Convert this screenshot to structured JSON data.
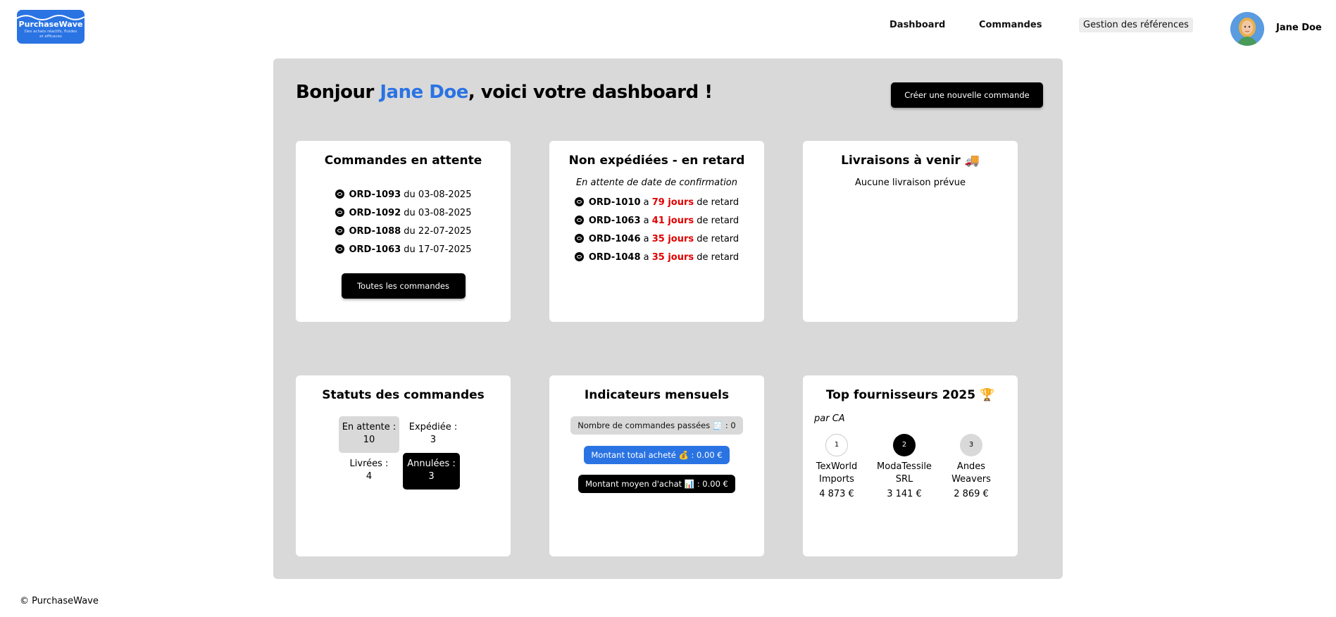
{
  "brand": {
    "name": "PurchaseWave",
    "tagline": "Des achats réactifs, fluides et efficaces"
  },
  "nav": {
    "dashboard": "Dashboard",
    "commandes": "Commandes",
    "references": "Gestion des références"
  },
  "user": {
    "name": "Jane Doe"
  },
  "greeting": {
    "prefix": "Bonjour ",
    "name": "Jane Doe",
    "suffix": ", voici votre dashboard !"
  },
  "new_order_button": "Créer une nouvelle commande",
  "pending": {
    "title": "Commandes en attente",
    "items": [
      {
        "id": "ORD-1093",
        "text": " du 03-08-2025"
      },
      {
        "id": "ORD-1092",
        "text": " du 03-08-2025"
      },
      {
        "id": "ORD-1088",
        "text": " du 22-07-2025"
      },
      {
        "id": "ORD-1063",
        "text": " du 17-07-2025"
      }
    ],
    "button": "Toutes les commandes"
  },
  "late": {
    "title": "Non expédiées - en retard",
    "subtitle": "En attente de date de confirmation",
    "items": [
      {
        "id": "ORD-1010",
        "a": " a ",
        "days": "79 jours",
        "suffix": " de retard"
      },
      {
        "id": "ORD-1063",
        "a": " a ",
        "days": "41 jours",
        "suffix": " de retard"
      },
      {
        "id": "ORD-1046",
        "a": " a ",
        "days": "35 jours",
        "suffix": " de retard"
      },
      {
        "id": "ORD-1048",
        "a": " a ",
        "days": "35 jours",
        "suffix": " de retard"
      }
    ]
  },
  "deliveries": {
    "title": "Livraisons à venir 🚚",
    "empty": "Aucune livraison prévue"
  },
  "statuses": {
    "title": "Statuts des commandes",
    "en_attente": {
      "label": "En attente :",
      "value": "10"
    },
    "expediee": {
      "label": "Expédiée :",
      "value": "3"
    },
    "livrees": {
      "label": "Livrées :",
      "value": "4"
    },
    "annulees": {
      "label": "Annulées :",
      "value": "3"
    }
  },
  "indicators": {
    "title": "Indicateurs mensuels",
    "orders_count": "Nombre de commandes passées 🧾 : 0",
    "total_amount": "Montant total acheté 💰 : 0.00 €",
    "average_amount": "Montant moyen d'achat 📊 : 0.00 €"
  },
  "top_suppliers": {
    "title": "Top fournisseurs 2025 🏆",
    "subtitle": "par CA",
    "items": [
      {
        "rank": "1",
        "name": "TexWorld Imports",
        "amount": "4 873 €"
      },
      {
        "rank": "2",
        "name": "ModaTessile SRL",
        "amount": "3 141 €"
      },
      {
        "rank": "3",
        "name": "Andes Weavers",
        "amount": "2 869 €"
      }
    ]
  },
  "footer": "© PurchaseWave",
  "colors": {
    "accent": "#2a73e3",
    "late": "#e10000",
    "panel": "#d9d9d9"
  }
}
